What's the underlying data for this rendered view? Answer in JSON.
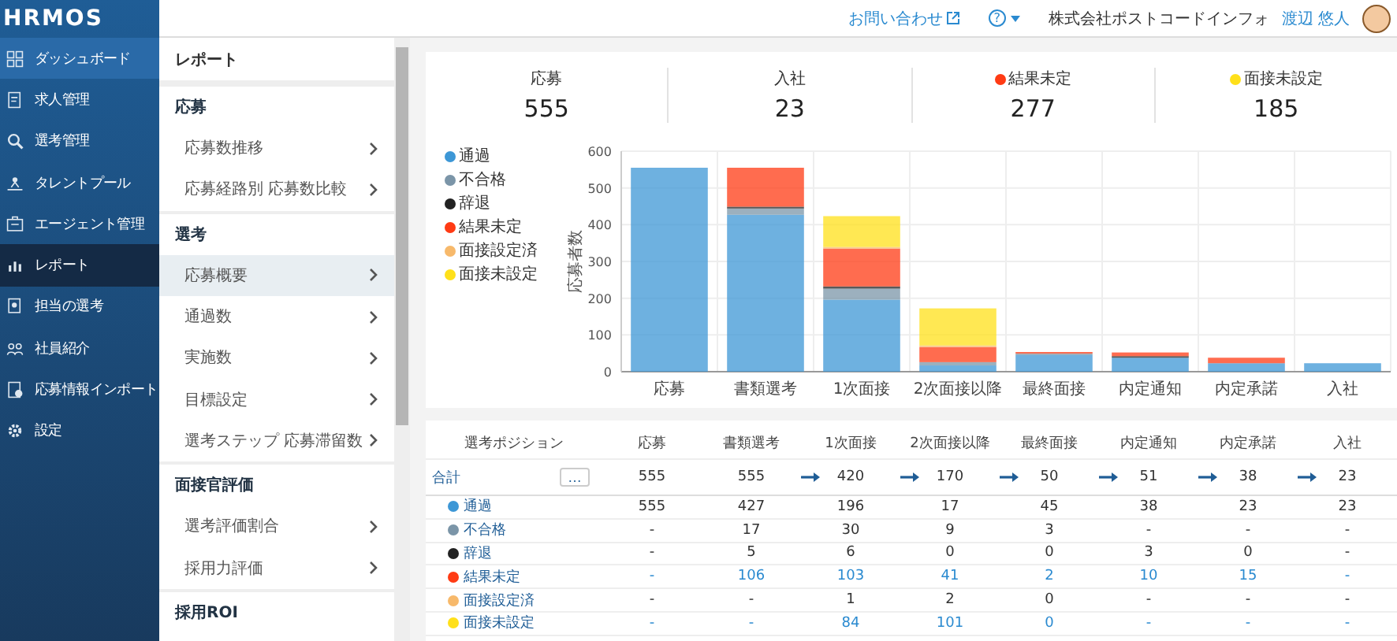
{
  "logo": "HRMOS",
  "sidebar": {
    "items": [
      {
        "label": "ダッシュボード",
        "selected": false,
        "hovered": true
      },
      {
        "label": "求人管理",
        "selected": false,
        "hovered": false
      },
      {
        "label": "選考管理",
        "selected": false,
        "hovered": false
      },
      {
        "label": "タレントプール",
        "selected": false,
        "hovered": false
      },
      {
        "label": "エージェント管理",
        "selected": false,
        "hovered": false
      },
      {
        "label": "レポート",
        "selected": true,
        "hovered": false
      },
      {
        "label": "担当の選考",
        "selected": false,
        "hovered": false
      },
      {
        "label": "社員紹介",
        "selected": false,
        "hovered": false
      },
      {
        "label": "応募情報インポート",
        "selected": false,
        "hovered": false
      },
      {
        "label": "設定",
        "selected": false,
        "hovered": false
      }
    ]
  },
  "header": {
    "contact_link": "お問い合わせ",
    "help": "?",
    "company": "株式会社ポストコードインフォ",
    "user": "渡辺 悠人"
  },
  "submenu": {
    "title": "レポート",
    "sections": [
      {
        "heading": "応募",
        "items": [
          {
            "label": "応募数推移",
            "selected": false
          },
          {
            "label": "応募経路別 応募数比較",
            "selected": false
          }
        ]
      },
      {
        "heading": "選考",
        "items": [
          {
            "label": "応募概要",
            "selected": true
          },
          {
            "label": "通過数",
            "selected": false
          },
          {
            "label": "実施数",
            "selected": false
          },
          {
            "label": "目標設定",
            "selected": false
          },
          {
            "label": "選考ステップ 応募滞留数",
            "selected": false
          }
        ]
      },
      {
        "heading": "面接官評価",
        "items": [
          {
            "label": "選考評価割合",
            "selected": false
          },
          {
            "label": "採用力評価",
            "selected": false
          }
        ]
      },
      {
        "heading": "採用ROI"
      }
    ]
  },
  "summary": [
    {
      "label": "応募",
      "value": "555"
    },
    {
      "label": "入社",
      "value": "23"
    },
    {
      "label": "結果未定",
      "value": "277",
      "color": "#ff3b14"
    },
    {
      "label": "面接未設定",
      "value": "185",
      "color": "#ffe01a"
    }
  ],
  "chart_data": {
    "type": "bar",
    "stacked": true,
    "grid": true,
    "ylabel": "応募者数",
    "categories": [
      "応募",
      "書類選考",
      "1次面接",
      "2次面接以降",
      "最終面接",
      "内定通知",
      "内定承諾",
      "入社"
    ],
    "ylim": [
      0,
      600
    ],
    "yticks": [
      0,
      100,
      200,
      300,
      400,
      500,
      600
    ],
    "series": [
      {
        "name": "通過",
        "color": "#3d97d6",
        "values": [
          555,
          427,
          196,
          17,
          45,
          38,
          23,
          23
        ]
      },
      {
        "name": "不合格",
        "color": "#7b95a8",
        "values": [
          null,
          17,
          30,
          9,
          3,
          null,
          null,
          null
        ]
      },
      {
        "name": "辞退",
        "color": "#222222",
        "values": [
          null,
          5,
          6,
          0,
          0,
          3,
          0,
          null
        ]
      },
      {
        "name": "結果未定",
        "color": "#ff3b14",
        "values": [
          null,
          106,
          103,
          41,
          2,
          10,
          15,
          null
        ]
      },
      {
        "name": "面接設定済",
        "color": "#f7b96b",
        "values": [
          null,
          null,
          1,
          2,
          0,
          null,
          null,
          null
        ]
      },
      {
        "name": "面接未設定",
        "color": "#ffe01a",
        "values": [
          null,
          null,
          84,
          101,
          0,
          null,
          null,
          null
        ]
      }
    ]
  },
  "table": {
    "columns": [
      "選考ポジション",
      "応募",
      "書類選考",
      "1次面接",
      "2次面接以降",
      "最終面接",
      "内定通知",
      "内定承諾",
      "入社"
    ],
    "total": {
      "label": "合計",
      "menu": "…",
      "values": [
        "555",
        "555",
        "420",
        "170",
        "50",
        "51",
        "38",
        "23"
      ]
    },
    "rows": [
      {
        "label": "通過",
        "color": "#3d97d6",
        "linked": false,
        "values": [
          "555",
          "427",
          "196",
          "17",
          "45",
          "38",
          "23",
          "23"
        ]
      },
      {
        "label": "不合格",
        "color": "#7b95a8",
        "linked": false,
        "values": [
          "-",
          "17",
          "30",
          "9",
          "3",
          "-",
          "-",
          "-"
        ]
      },
      {
        "label": "辞退",
        "color": "#222222",
        "linked": false,
        "values": [
          "-",
          "5",
          "6",
          "0",
          "0",
          "3",
          "0",
          "-"
        ]
      },
      {
        "label": "結果未定",
        "color": "#ff3b14",
        "linked": true,
        "values": [
          "-",
          "106",
          "103",
          "41",
          "2",
          "10",
          "15",
          "-"
        ]
      },
      {
        "label": "面接設定済",
        "color": "#f7b96b",
        "linked": false,
        "values": [
          "-",
          "-",
          "1",
          "2",
          "0",
          "-",
          "-",
          "-"
        ]
      },
      {
        "label": "面接未設定",
        "color": "#ffe01a",
        "linked": true,
        "values": [
          "-",
          "-",
          "84",
          "101",
          "0",
          "-",
          "-",
          "-"
        ]
      }
    ]
  }
}
